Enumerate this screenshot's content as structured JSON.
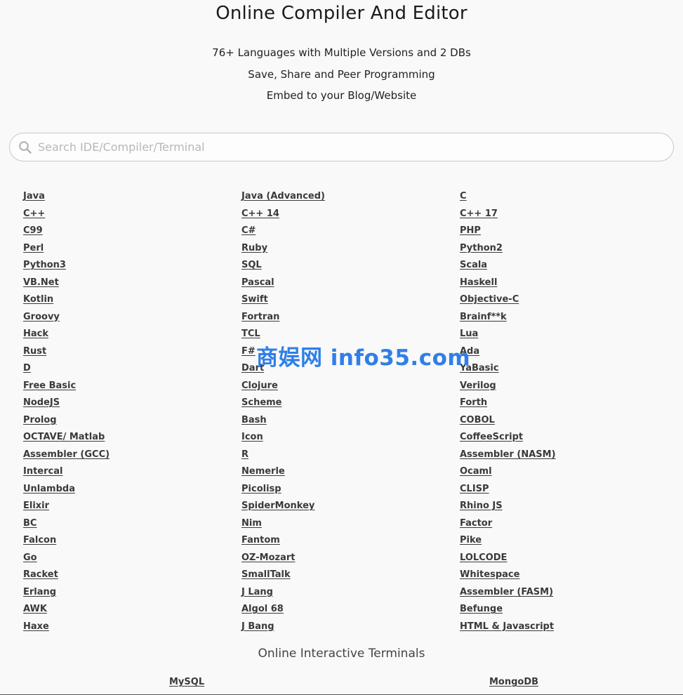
{
  "header": {
    "title": "Online Compiler And Editor",
    "taglines": [
      "76+ Languages with Multiple Versions and 2 DBs",
      "Save, Share and Peer Programming",
      "Embed to your Blog/Website"
    ]
  },
  "search": {
    "placeholder": "Search IDE/Compiler/Terminal",
    "icon": "search-icon"
  },
  "languages": {
    "col1": [
      "Java",
      "C++",
      "C99",
      "Perl",
      "Python3",
      "VB.Net",
      "Kotlin",
      "Groovy",
      "Hack",
      "Rust",
      "D",
      "Free Basic",
      "NodeJS",
      "Prolog",
      "OCTAVE/ Matlab",
      "Assembler (GCC)",
      "Intercal",
      "Unlambda",
      "Elixir",
      "BC",
      "Falcon",
      "Go",
      "Racket",
      "Erlang",
      "AWK",
      "Haxe"
    ],
    "col2": [
      "Java (Advanced)",
      "C++ 14",
      "C#",
      "Ruby",
      "SQL",
      "Pascal",
      "Swift",
      "Fortran",
      "TCL",
      "F#",
      "Dart",
      "Clojure",
      "Scheme",
      "Bash",
      "Icon",
      "R",
      "Nemerle",
      "Picolisp",
      "SpiderMonkey",
      "Nim",
      "Fantom",
      "OZ-Mozart",
      "SmallTalk",
      "J Lang",
      "Algol 68",
      "J Bang"
    ],
    "col3": [
      "C",
      "C++ 17",
      "PHP",
      "Python2",
      "Scala",
      "Haskell",
      "Objective-C",
      "Brainf**k",
      "Lua",
      "Ada",
      "YaBasic",
      "Verilog",
      "Forth",
      "COBOL",
      "CoffeeScript",
      "Assembler (NASM)",
      "Ocaml",
      "CLISP",
      "Rhino JS",
      "Factor",
      "Pike",
      "LOLCODE",
      "Whitespace",
      "Assembler (FASM)",
      "Befunge",
      "HTML & Javascript"
    ]
  },
  "terminals": {
    "heading": "Online Interactive Terminals",
    "items": [
      "MySQL",
      "MongoDB"
    ]
  },
  "watermark": "商娱网 info35.com",
  "colors": {
    "background": "#f9f9f9",
    "link": "#3a3a3a",
    "watermark": "#2f7fe8"
  }
}
